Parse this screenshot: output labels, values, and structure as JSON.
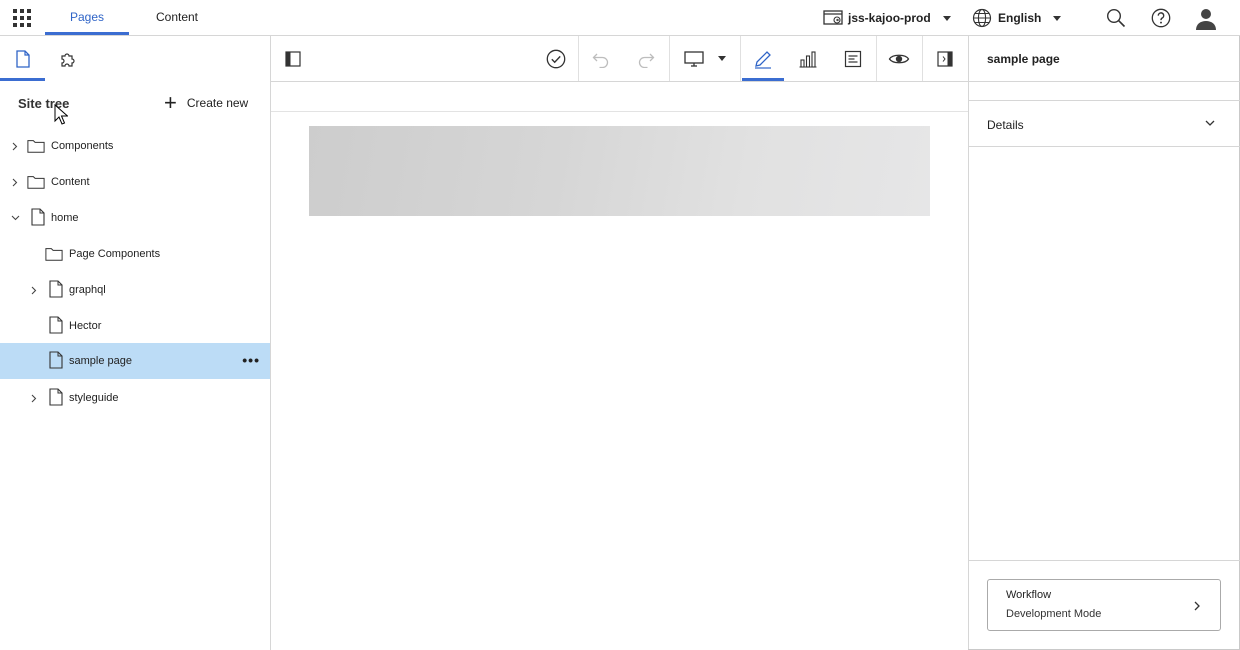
{
  "topbar": {
    "tabs": [
      {
        "label": "Pages",
        "active": true
      },
      {
        "label": "Content",
        "active": false
      }
    ],
    "site_selector": {
      "label": "jss-kajoo-prod",
      "icon": "site-icon"
    },
    "language_selector": {
      "label": "English",
      "icon": "globe-icon"
    },
    "icons": [
      "apps-grid-icon",
      "search-icon",
      "help-icon",
      "user-avatar-icon"
    ]
  },
  "left_panel": {
    "tabs": [
      {
        "icon": "page-icon",
        "active": true
      },
      {
        "icon": "puzzle-icon",
        "active": false
      }
    ],
    "title": "Site tree",
    "create_new": "Create new",
    "tree": [
      {
        "label": "Components",
        "type": "folder",
        "expandable": true,
        "expanded": false,
        "depth": 0
      },
      {
        "label": "Content",
        "type": "folder",
        "expandable": true,
        "expanded": false,
        "depth": 0
      },
      {
        "label": "home",
        "type": "page",
        "expandable": true,
        "expanded": true,
        "depth": 0
      },
      {
        "label": "Page Components",
        "type": "folder",
        "expandable": false,
        "depth": 1
      },
      {
        "label": "graphql",
        "type": "page",
        "expandable": true,
        "expanded": false,
        "depth": 1
      },
      {
        "label": "Hector",
        "type": "page",
        "expandable": false,
        "depth": 1
      },
      {
        "label": "sample page",
        "type": "page",
        "expandable": false,
        "depth": 1,
        "selected": true
      },
      {
        "label": "styleguide",
        "type": "page",
        "expandable": true,
        "expanded": false,
        "depth": 1
      }
    ]
  },
  "toolbar": {
    "buttons": [
      "collapse-left-panel-icon",
      "check-circle-icon",
      "undo-icon",
      "redo-icon",
      "desktop-device-icon",
      "edit-pencil-icon",
      "analytics-chart-icon",
      "page-details-icon",
      "preview-eye-icon",
      "collapse-right-panel-icon"
    ],
    "active": "edit-pencil-icon"
  },
  "right_panel": {
    "title": "sample page",
    "details_label": "Details",
    "workflow": {
      "title": "Workflow",
      "state": "Development Mode"
    }
  },
  "colors": {
    "accent": "#3b6dd1",
    "selected_row": "#bcdcf6",
    "border": "#d6d6d6"
  }
}
